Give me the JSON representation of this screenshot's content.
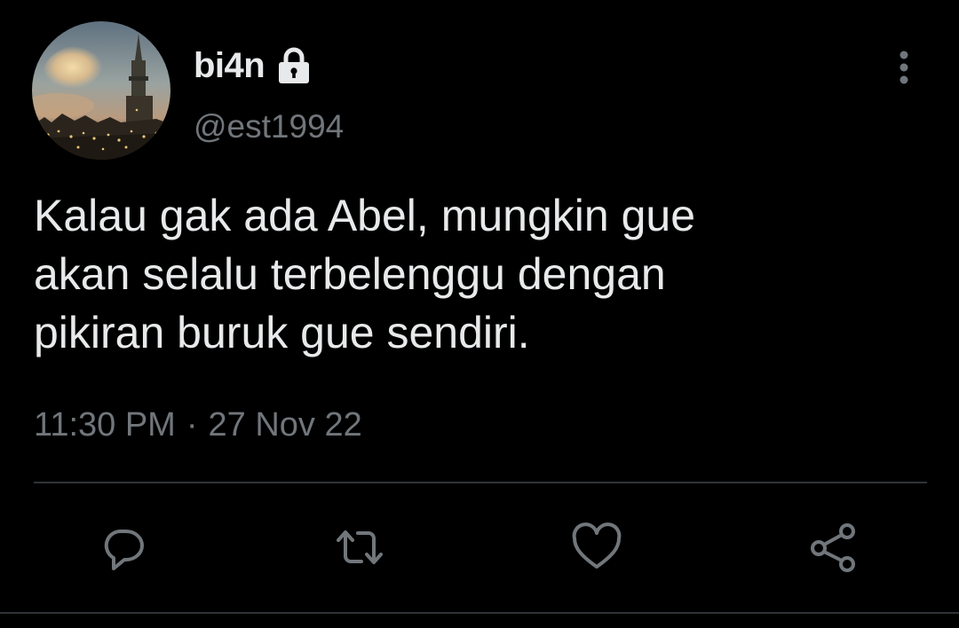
{
  "author": {
    "display_name": "bi4n",
    "handle": "@est1994",
    "protected": true
  },
  "tweet": {
    "text": "Kalau gak ada Abel, mungkin gue\nakan selalu terbelenggu dengan\npikiran buruk gue sendiri.",
    "time": "11:30 PM",
    "separator": "·",
    "date": "27 Nov 22"
  },
  "actions": {
    "reply": "reply-icon",
    "retweet": "retweet-icon",
    "like": "heart-icon",
    "share": "share-icon"
  },
  "colors": {
    "background": "#000000",
    "primary_text": "#e7e9ea",
    "secondary_text": "#71767b",
    "divider": "#2f3336",
    "icon": "#71767b"
  }
}
